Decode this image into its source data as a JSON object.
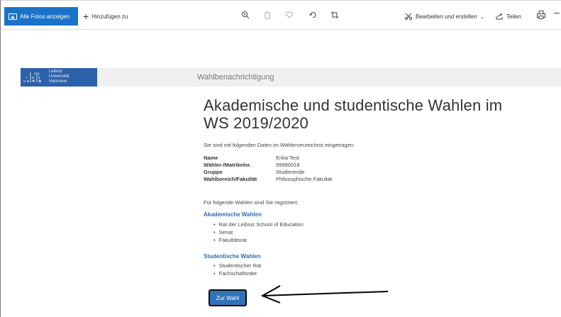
{
  "toolbar": {
    "all_photos": "Alle Fotos anzeigen",
    "add_to": "Hinzufügen zu",
    "edit_create": "Bearbeiten und erstellen",
    "share": "Teilen"
  },
  "header": {
    "logo_lines": [
      "Leibniz",
      "Universität",
      "Hannover"
    ],
    "title": "Wahlbenachrichtigung"
  },
  "main": {
    "heading_line1": "Akademische und studentische Wahlen im",
    "heading_line2": "WS 2019/2020",
    "intro": "Sie sind mit folgenden Daten im Wählerverzeichnis eingetragen:",
    "info": [
      {
        "label": "Name",
        "value": "Erika Test"
      },
      {
        "label": "Wähler-/Matrikelnr.",
        "value": "99990018"
      },
      {
        "label": "Gruppe",
        "value": "Studierende"
      },
      {
        "label": "Wahlbereich/Fakultät",
        "value": "Philosophische Fakultät"
      }
    ],
    "registered_text": "Für folgende Wahlen sind Sie registriert:",
    "academic": {
      "title": "Akademische Wahlen",
      "items": [
        "Rat der Leibniz School of Education",
        "Senat",
        "Fakultätsrat"
      ]
    },
    "student": {
      "title": "Studentische Wahlen",
      "items": [
        "Studentischer Rat",
        "Fachschaftsräte"
      ]
    },
    "vote_button": "Zur Wahl"
  },
  "colors": {
    "accent": "#1a73c9",
    "luh_blue": "#2b61a8",
    "section_blue": "#2b6cb0",
    "button_blue": "#2f72b8"
  }
}
